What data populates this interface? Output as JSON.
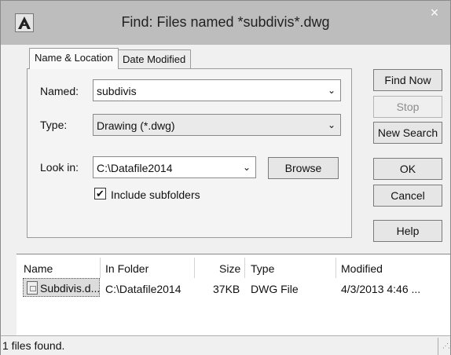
{
  "window": {
    "title": "Find: Files named *subdivis*.dwg",
    "close_glyph": "×",
    "app_icon": "autocad-icon"
  },
  "tabs": [
    {
      "label": "Name & Location",
      "active": true
    },
    {
      "label": "Date Modified",
      "active": false
    }
  ],
  "form": {
    "named_label": "Named:",
    "named_value": "subdivis",
    "type_label": "Type:",
    "type_value": "Drawing (*.dwg)",
    "lookin_label": "Look in:",
    "lookin_value": "C:\\Datafile2014",
    "browse_label": "Browse",
    "include_subfolders_label": "Include subfolders",
    "include_subfolders_checked": true
  },
  "buttons": {
    "find_now": "Find Now",
    "stop": "Stop",
    "new_search": "New Search",
    "ok": "OK",
    "cancel": "Cancel",
    "help": "Help"
  },
  "results": {
    "columns": [
      "Name",
      "In Folder",
      "Size",
      "Type",
      "Modified"
    ],
    "rows": [
      {
        "name": "Subdivis.d...",
        "folder": "C:\\Datafile2014",
        "size": "37KB",
        "type": "DWG File",
        "modified": "4/3/2013 4:46 ..."
      }
    ]
  },
  "status": {
    "text": "1 files found."
  },
  "glyphs": {
    "dropdown": "⌄",
    "check": "✔"
  }
}
